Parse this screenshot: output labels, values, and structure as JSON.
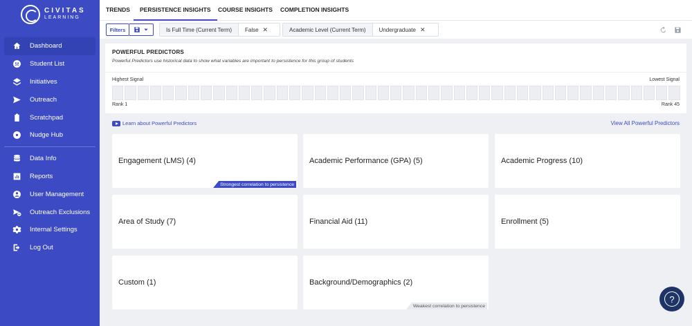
{
  "brand": {
    "line1": "CIVITAS",
    "line2": "LEARNING"
  },
  "nav": [
    {
      "label": "Dashboard",
      "icon": "home-icon",
      "active": true
    },
    {
      "label": "Student List",
      "icon": "students-icon"
    },
    {
      "label": "Initiatives",
      "icon": "layers-icon"
    },
    {
      "label": "Outreach",
      "icon": "send-icon"
    },
    {
      "label": "Scratchpad",
      "icon": "clipboard-icon"
    },
    {
      "label": "Nudge Hub",
      "icon": "hub-icon"
    },
    {
      "label": "Data Info",
      "icon": "database-icon"
    },
    {
      "label": "Reports",
      "icon": "chart-icon"
    },
    {
      "label": "User Management",
      "icon": "users-icon"
    },
    {
      "label": "Outreach Exclusions",
      "icon": "exclusions-icon"
    },
    {
      "label": "Internal Settings",
      "icon": "gear-icon"
    },
    {
      "label": "Log Out",
      "icon": "logout-icon"
    }
  ],
  "tabs": [
    "TRENDS",
    "PERSISTENCE INSIGHTS",
    "COURSE INSIGHTS",
    "COMPLETION INSIGHTS"
  ],
  "filters": {
    "filters_label": "Filters",
    "chips": [
      {
        "key": "Is Full Time (Current Term)",
        "value": "False"
      },
      {
        "key": "Academic Level (Current Term)",
        "value": "Undergraduate"
      }
    ]
  },
  "predictors": {
    "title": "POWERFUL PREDICTORS",
    "subtitle": "Powerful Predictors use historical data to show what variables are important to persistence for this group of students",
    "highest": "Highest Signal",
    "lowest": "Lowest Signal",
    "rank_first": "Rank 1",
    "rank_last": "Rank 45",
    "bar_count": 45
  },
  "links": {
    "learn": "Learn about Powerful Predictors",
    "view_all": "View All Powerful Predictors"
  },
  "cards": [
    {
      "title": "Engagement (LMS) (4)",
      "note": "Strongest correlation to persistence",
      "note_type": "strong"
    },
    {
      "title": "Academic Performance (GPA) (5)"
    },
    {
      "title": "Academic Progress (10)"
    },
    {
      "title": "Area of Study (7)"
    },
    {
      "title": "Financial Aid (11)"
    },
    {
      "title": "Enrollment (5)"
    },
    {
      "title": "Custom (1)"
    },
    {
      "title": "Background/Demographics (2)",
      "note": "Weakest correlation to persistence",
      "note_type": "weak"
    }
  ],
  "help": "?"
}
